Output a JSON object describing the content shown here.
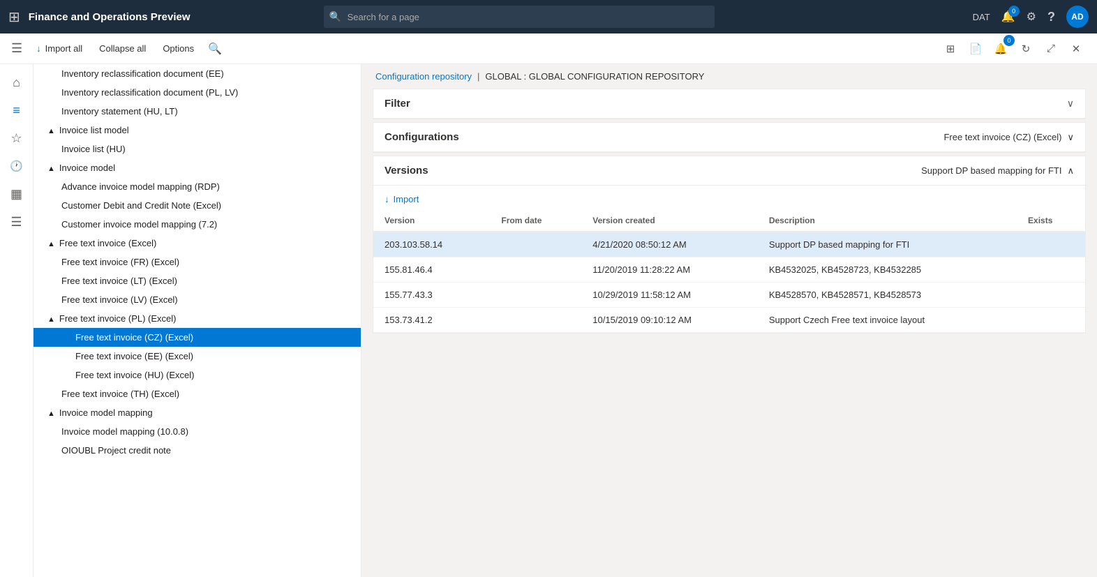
{
  "app": {
    "title": "Finance and Operations Preview",
    "env_label": "DAT",
    "avatar_initials": "AD"
  },
  "search": {
    "placeholder": "Search for a page"
  },
  "toolbar": {
    "import_all": "Import all",
    "collapse_all": "Collapse all",
    "options": "Options"
  },
  "breadcrumb": {
    "repo": "Configuration repository",
    "separator": "|",
    "current": "GLOBAL : GLOBAL CONFIGURATION REPOSITORY"
  },
  "filter_section": {
    "title": "Filter",
    "collapsed": true
  },
  "configurations_section": {
    "title": "Configurations",
    "selected_config": "Free text invoice (CZ) (Excel)"
  },
  "versions_section": {
    "title": "Versions",
    "right_label": "Support DP based mapping for FTI",
    "import_btn": "Import",
    "columns": [
      "Version",
      "From date",
      "Version created",
      "Description",
      "Exists"
    ],
    "rows": [
      {
        "version": "203.103.58.14",
        "from_date": "",
        "version_created": "4/21/2020 08:50:12 AM",
        "description": "Support DP based mapping for FTI",
        "exists": "",
        "selected": true
      },
      {
        "version": "155.81.46.4",
        "from_date": "",
        "version_created": "11/20/2019 11:28:22 AM",
        "description": "KB4532025, KB4528723, KB4532285",
        "exists": "",
        "selected": false
      },
      {
        "version": "155.77.43.3",
        "from_date": "",
        "version_created": "10/29/2019 11:58:12 AM",
        "description": "KB4528570, KB4528571, KB4528573",
        "exists": "",
        "selected": false
      },
      {
        "version": "153.73.41.2",
        "from_date": "",
        "version_created": "10/15/2019 09:10:12 AM",
        "description": "Support Czech Free text invoice layout",
        "exists": "",
        "selected": false
      }
    ]
  },
  "tree": {
    "items": [
      {
        "label": "Inventory reclassification document (EE)",
        "level": 1,
        "indent": 1,
        "collapse": false
      },
      {
        "label": "Inventory reclassification document (PL, LV)",
        "level": 1,
        "indent": 1,
        "collapse": false
      },
      {
        "label": "Inventory statement (HU, LT)",
        "level": 1,
        "indent": 1,
        "collapse": false
      },
      {
        "label": "Invoice list model",
        "level": 0,
        "indent": 0,
        "collapse": true
      },
      {
        "label": "Invoice list (HU)",
        "level": 1,
        "indent": 1,
        "collapse": false
      },
      {
        "label": "Invoice model",
        "level": 0,
        "indent": 0,
        "collapse": true
      },
      {
        "label": "Advance invoice model mapping (RDP)",
        "level": 1,
        "indent": 1,
        "collapse": false
      },
      {
        "label": "Customer Debit and Credit Note (Excel)",
        "level": 1,
        "indent": 1,
        "collapse": false
      },
      {
        "label": "Customer invoice model mapping (7.2)",
        "level": 1,
        "indent": 1,
        "collapse": false
      },
      {
        "label": "Free text invoice (Excel)",
        "level": 0,
        "indent": 0,
        "collapse": true
      },
      {
        "label": "Free text invoice (FR) (Excel)",
        "level": 1,
        "indent": 1,
        "collapse": false
      },
      {
        "label": "Free text invoice (LT) (Excel)",
        "level": 1,
        "indent": 1,
        "collapse": false
      },
      {
        "label": "Free text invoice (LV) (Excel)",
        "level": 1,
        "indent": 1,
        "collapse": false
      },
      {
        "label": "Free text invoice (PL) (Excel)",
        "level": 0,
        "indent": 0,
        "collapse": true
      },
      {
        "label": "Free text invoice (CZ) (Excel)",
        "level": 2,
        "indent": 2,
        "collapse": false,
        "selected": true
      },
      {
        "label": "Free text invoice (EE) (Excel)",
        "level": 1,
        "indent": 2,
        "collapse": false
      },
      {
        "label": "Free text invoice (HU) (Excel)",
        "level": 1,
        "indent": 2,
        "collapse": false
      },
      {
        "label": "Free text invoice (TH) (Excel)",
        "level": 0,
        "indent": 1,
        "collapse": false
      },
      {
        "label": "Invoice model mapping",
        "level": 0,
        "indent": 0,
        "collapse": true
      },
      {
        "label": "Invoice model mapping (10.0.8)",
        "level": 1,
        "indent": 1,
        "collapse": false
      },
      {
        "label": "OIOUBL Project credit note",
        "level": 1,
        "indent": 1,
        "collapse": false
      }
    ]
  },
  "icons": {
    "apps_grid": "⊞",
    "search": "🔍",
    "bell": "🔔",
    "gear": "⚙",
    "question": "?",
    "home": "⌂",
    "filter": "≡",
    "star": "☆",
    "history": "⏱",
    "grid": "⊞",
    "list": "☰",
    "import_down": "↓",
    "collapse_up": "∧",
    "expand_down": "∨",
    "chevron_right": "›",
    "collapse_tri": "▲",
    "expand_tri": "▼",
    "notification_count": "0",
    "settings_icon": "⚙",
    "sync": "↻",
    "open_new": "⤢",
    "close": "✕"
  }
}
